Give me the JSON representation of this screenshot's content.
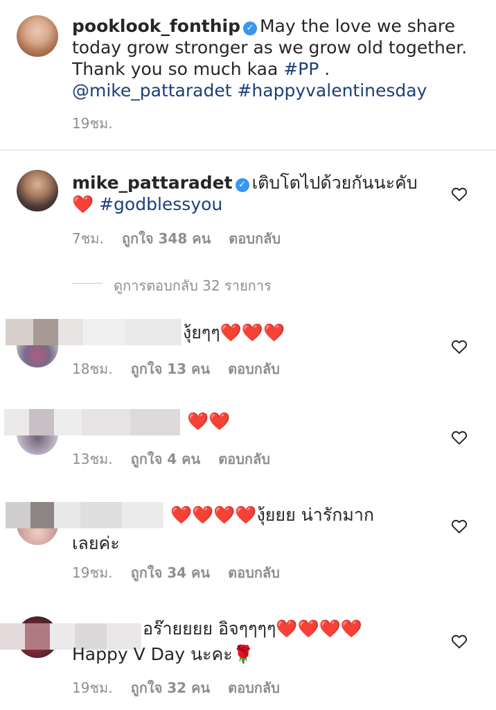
{
  "caption": {
    "username": "pooklook_fonthip",
    "text_line1": "May the love we share",
    "text_line2": "today grow stronger as we grow old together.",
    "text_line3_prefix": "Thank you so much kaa ",
    "hashtag_pp": "#PP",
    "text_line3_suffix": " .",
    "mention": "@mike_pattaradet",
    "hashtag_valentine": "#happyvalentinesday",
    "time": "19ชม."
  },
  "comments": [
    {
      "username": "mike_pattaradet",
      "text": "เติบโตไปด้วยกันนะคับ",
      "hashtag": "#godblessyou",
      "time": "7ชม.",
      "likes": "ถูกใจ 348 คน",
      "reply_label": "ตอบกลับ",
      "view_replies": "ดูการตอบกลับ 32 รายการ"
    },
    {
      "text": "งุ้ยๆๆ",
      "time": "18ชม.",
      "likes": "ถูกใจ 13 คน",
      "reply_label": "ตอบกลับ"
    },
    {
      "text": "",
      "time": "13ชม.",
      "likes": "ถูกใจ 4 คน",
      "reply_label": "ตอบกลับ"
    },
    {
      "text": "งุ้ยยย น่ารักมาก",
      "text_line2": "เลยค่ะ",
      "time": "19ชม.",
      "likes": "ถูกใจ 34 คน",
      "reply_label": "ตอบกลับ"
    },
    {
      "text": "อร๊ายยยย อิจๆๆๆๆ",
      "text_line2": "Happy V Day นะคะ",
      "time": "19ชม.",
      "likes": "ถูกใจ 32 คน",
      "reply_label": "ตอบกลับ"
    }
  ],
  "icons": {
    "heart_emoji": "❤️",
    "rose_emoji": "🌹",
    "verified": "✓",
    "like_icon": "heart-outline"
  },
  "colors": {
    "link": "#1b3f7a",
    "meta": "#8e8e8e",
    "verified": "#3897f0",
    "heart": "#e31b2d"
  }
}
